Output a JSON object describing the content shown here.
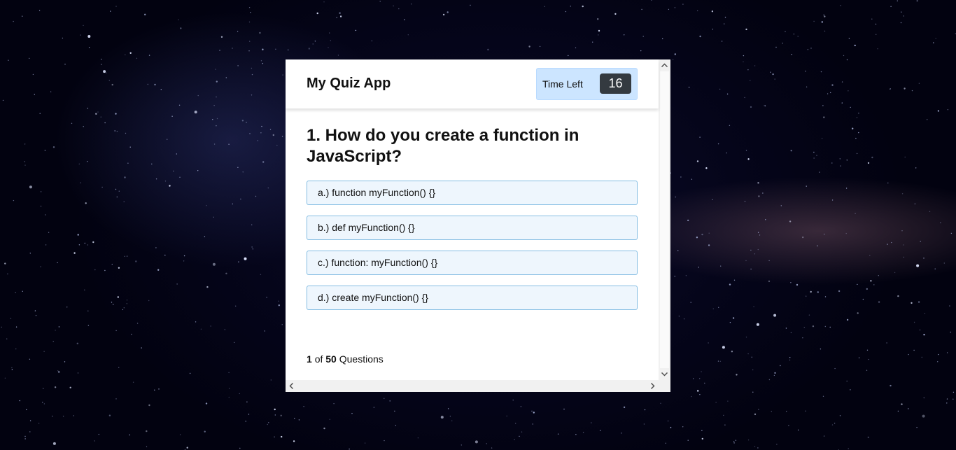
{
  "app": {
    "title": "My Quiz App"
  },
  "timer": {
    "label": "Time Left",
    "value": "16"
  },
  "question": {
    "text": "1. How do you create a function in JavaScript?"
  },
  "options": [
    {
      "label": "a.) function myFunction() {}"
    },
    {
      "label": "b.) def myFunction() {}"
    },
    {
      "label": "c.) function: myFunction() {}"
    },
    {
      "label": "d.) create myFunction() {}"
    }
  ],
  "footer": {
    "current": "1",
    "of_text": "of",
    "total": "50",
    "suffix": "Questions"
  },
  "icons": {
    "scroll_up": "chevron-up-icon",
    "scroll_down": "chevron-down-icon",
    "scroll_left": "chevron-left-icon",
    "scroll_right": "chevron-right-icon"
  },
  "colors": {
    "timer_bg": "#cce5ff",
    "timer_value_bg": "#343a40",
    "option_bg": "#eef6fd",
    "option_border": "#84bde3"
  }
}
